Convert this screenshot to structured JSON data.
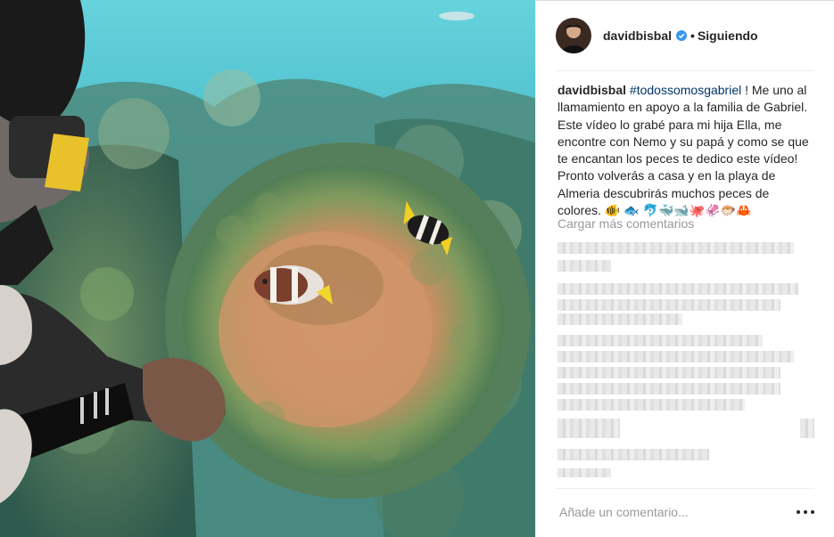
{
  "post": {
    "username": "davidbisbal",
    "follow_status": "Siguiendo",
    "separator_dot": "•",
    "verified_icon": "verified-badge-icon",
    "caption": {
      "username": "davidbisbal",
      "hashtag": "#todossomosgabriel",
      "text": " ! Me uno al llamamiento en apoyo a la familia de Gabriel. Este vídeo lo grabé para mi hija Ella, me encontre con Nemo y su papá y como se que te encantan los peces te dedico este vídeo! Pronto volverás a casa y en la playa de Almeria descubrirás muchos peces de colores.",
      "emojis": "🐠 🐟 🐬🐳🐋🐙🦑🐡🦀"
    },
    "load_more": "Cargar más comentarios",
    "add_comment_placeholder": "Añade un comentario...",
    "more_icon": "ellipsis-icon"
  },
  "colors": {
    "text": "#262626",
    "hashtag": "#003569",
    "muted": "#999999",
    "verified": "#3897f0",
    "water": "#5ec9d6"
  }
}
